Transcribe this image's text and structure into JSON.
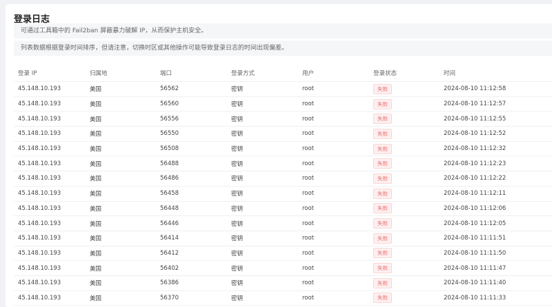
{
  "page": {
    "title": "登录日志",
    "notice1": "可通过工具箱中的 Fail2ban 屏蔽暴力破解 IP，从而保护主机安全。",
    "notice2": "列表数据根据登录时间排序，但请注意，切换时区或其他操作可能导致登录日志的时间出现偏差。"
  },
  "table": {
    "columns": [
      "登录 IP",
      "归属地",
      "端口",
      "登录方式",
      "用户",
      "登录状态",
      "时间"
    ],
    "rows": [
      {
        "ip": "45.148.10.193",
        "region": "美国",
        "port": "56562",
        "method": "密钥",
        "user": "root",
        "status": "失败",
        "time": "2024-08-10 11:12:58"
      },
      {
        "ip": "45.148.10.193",
        "region": "美国",
        "port": "56560",
        "method": "密钥",
        "user": "root",
        "status": "失败",
        "time": "2024-08-10 11:12:57"
      },
      {
        "ip": "45.148.10.193",
        "region": "美国",
        "port": "56556",
        "method": "密钥",
        "user": "root",
        "status": "失败",
        "time": "2024-08-10 11:12:55"
      },
      {
        "ip": "45.148.10.193",
        "region": "美国",
        "port": "56550",
        "method": "密钥",
        "user": "root",
        "status": "失败",
        "time": "2024-08-10 11:12:52"
      },
      {
        "ip": "45.148.10.193",
        "region": "美国",
        "port": "56508",
        "method": "密钥",
        "user": "root",
        "status": "失败",
        "time": "2024-08-10 11:12:32"
      },
      {
        "ip": "45.148.10.193",
        "region": "美国",
        "port": "56488",
        "method": "密钥",
        "user": "root",
        "status": "失败",
        "time": "2024-08-10 11:12:23"
      },
      {
        "ip": "45.148.10.193",
        "region": "美国",
        "port": "56486",
        "method": "密钥",
        "user": "root",
        "status": "失败",
        "time": "2024-08-10 11:12:22"
      },
      {
        "ip": "45.148.10.193",
        "region": "美国",
        "port": "56458",
        "method": "密钥",
        "user": "root",
        "status": "失败",
        "time": "2024-08-10 11:12:11"
      },
      {
        "ip": "45.148.10.193",
        "region": "美国",
        "port": "56448",
        "method": "密钥",
        "user": "root",
        "status": "失败",
        "time": "2024-08-10 11:12:06"
      },
      {
        "ip": "45.148.10.193",
        "region": "美国",
        "port": "56446",
        "method": "密钥",
        "user": "root",
        "status": "失败",
        "time": "2024-08-10 11:12:05"
      },
      {
        "ip": "45.148.10.193",
        "region": "美国",
        "port": "56414",
        "method": "密钥",
        "user": "root",
        "status": "失败",
        "time": "2024-08-10 11:11:51"
      },
      {
        "ip": "45.148.10.193",
        "region": "美国",
        "port": "56412",
        "method": "密钥",
        "user": "root",
        "status": "失败",
        "time": "2024-08-10 11:11:50"
      },
      {
        "ip": "45.148.10.193",
        "region": "美国",
        "port": "56402",
        "method": "密钥",
        "user": "root",
        "status": "失败",
        "time": "2024-08-10 11:11:47"
      },
      {
        "ip": "45.148.10.193",
        "region": "美国",
        "port": "56386",
        "method": "密钥",
        "user": "root",
        "status": "失败",
        "time": "2024-08-10 11:11:40"
      },
      {
        "ip": "45.148.10.193",
        "region": "美国",
        "port": "56370",
        "method": "密钥",
        "user": "root",
        "status": "失败",
        "time": "2024-08-10 11:11:33"
      }
    ]
  },
  "colors": {
    "badge_fail_text": "#f56c6c",
    "badge_fail_bg": "#fef0f0",
    "badge_fail_border": "#fcd4d4"
  }
}
